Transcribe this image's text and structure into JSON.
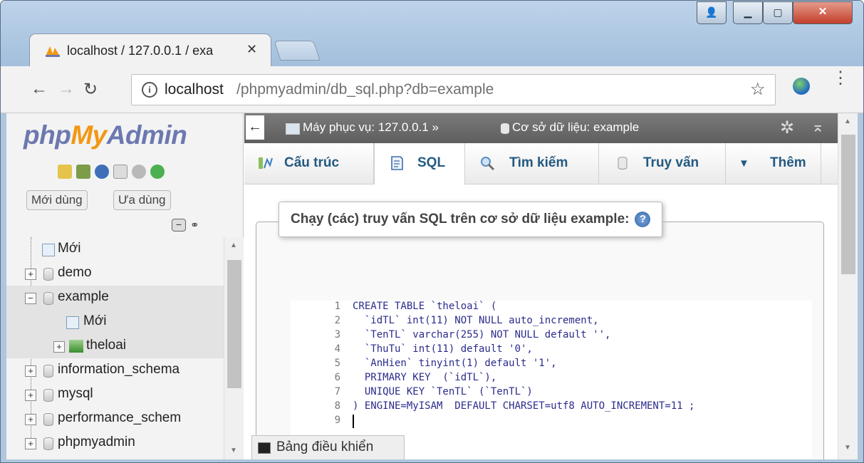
{
  "browser": {
    "tab_title": "localhost / 127.0.0.1 / exa",
    "url_host": "localhost",
    "url_path": "/phpmyadmin/db_sql.php?db=example"
  },
  "logo": {
    "php": "php",
    "my": "My",
    "admin": "Admin"
  },
  "sidebar": {
    "recent_label": "Mới dùng",
    "favorites_label": "Ưa dùng",
    "tree": [
      {
        "label": "Mới",
        "icon": "new-db-icon"
      },
      {
        "label": "demo",
        "icon": "database-icon"
      },
      {
        "label": "example",
        "icon": "database-icon",
        "selected": true
      },
      {
        "label": "Mới",
        "icon": "new-table-icon"
      },
      {
        "label": "theloai",
        "icon": "table-icon"
      },
      {
        "label": "information_schema",
        "icon": "database-icon"
      },
      {
        "label": "mysql",
        "icon": "database-icon"
      },
      {
        "label": "performance_schem",
        "icon": "database-icon"
      },
      {
        "label": "phpmyadmin",
        "icon": "database-icon"
      }
    ]
  },
  "breadcrumb": {
    "server": "Máy phục vụ: 127.0.0.1",
    "separator": "»",
    "database": "Cơ sở dữ liệu: example"
  },
  "tabs": [
    {
      "label": "Cấu trúc",
      "icon": "structure-icon"
    },
    {
      "label": "SQL",
      "icon": "sql-icon",
      "active": true
    },
    {
      "label": "Tìm kiếm",
      "icon": "search-icon"
    },
    {
      "label": "Truy vấn",
      "icon": "query-icon"
    },
    {
      "label": "Thêm",
      "icon": "more-dropdown-icon"
    }
  ],
  "sql_panel": {
    "legend": "Chạy (các) truy vấn SQL trên cơ sở dữ liệu example:",
    "lines": [
      {
        "num": "1",
        "code": "CREATE TABLE `theloai` ("
      },
      {
        "num": "2",
        "code": "  `idTL` int(11) NOT NULL auto_increment,"
      },
      {
        "num": "3",
        "code": "  `TenTL` varchar(255) NOT NULL default '',"
      },
      {
        "num": "4",
        "code": "  `ThuTu` int(11) default '0',"
      },
      {
        "num": "5",
        "code": "  `AnHien` tinyint(1) default '1',"
      },
      {
        "num": "6",
        "code": "  PRIMARY KEY  (`idTL`),"
      },
      {
        "num": "7",
        "code": "  UNIQUE KEY `TenTL` (`TenTL`)"
      },
      {
        "num": "8",
        "code": ") ENGINE=MyISAM  DEFAULT CHARSET=utf8 AUTO_INCREMENT=11 ;"
      },
      {
        "num": "9",
        "code": ""
      }
    ]
  },
  "console": {
    "label": "Bảng điều khiển"
  },
  "colors": {
    "link_blue": "#235a81",
    "logo_blue": "#6c78b0",
    "logo_orange": "#f29811",
    "breadcrumb_bg": "#6e6e6e"
  }
}
